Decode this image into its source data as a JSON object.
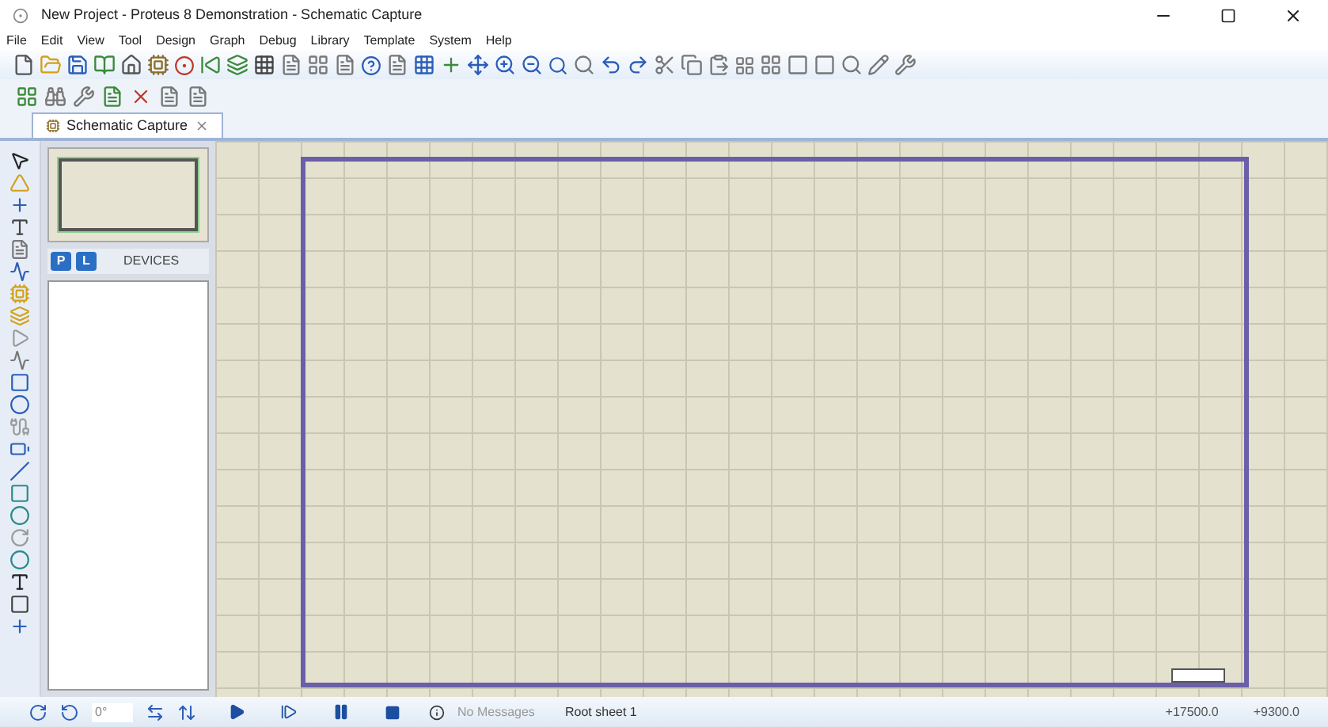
{
  "window": {
    "title": "New Project - Proteus 8 Demonstration - Schematic Capture"
  },
  "menu": [
    "File",
    "Edit",
    "View",
    "Tool",
    "Design",
    "Graph",
    "Debug",
    "Library",
    "Template",
    "System",
    "Help"
  ],
  "tabs": [
    {
      "label": "Schematic Capture",
      "selected": true
    }
  ],
  "devices_panel": {
    "pick_button": "P",
    "library_button": "L",
    "title": "DEVICES"
  },
  "status_bar": {
    "rotation": "0°",
    "messages": "No Messages",
    "sheet": "Root sheet 1",
    "x": "+17500.0",
    "y": "+9300.0"
  }
}
